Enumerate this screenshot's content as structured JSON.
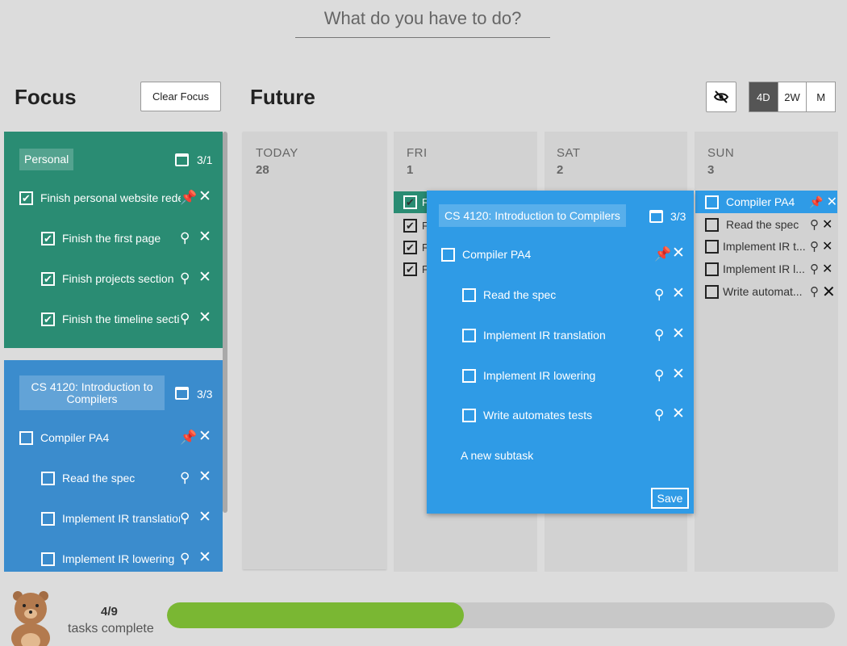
{
  "search": {
    "placeholder": "What do you have to do?"
  },
  "focus": {
    "title": "Focus",
    "clear_label": "Clear Focus",
    "groups": [
      {
        "tag": "Personal",
        "count": "3/1",
        "color": "#2a8c73",
        "task": {
          "label": "Finish personal website redesign",
          "checked": true
        },
        "subtasks": [
          {
            "label": "Finish the first page",
            "checked": true
          },
          {
            "label": "Finish projects section",
            "checked": true
          },
          {
            "label": "Finish the timeline section",
            "checked": true
          }
        ]
      },
      {
        "tag": "CS 4120: Introduction to Compilers",
        "count": "3/3",
        "color": "#3b8ccd",
        "task": {
          "label": "Compiler PA4",
          "checked": false
        },
        "subtasks": [
          {
            "label": "Read the spec",
            "checked": false
          },
          {
            "label": "Implement IR translation",
            "checked": false
          },
          {
            "label": "Implement IR lowering",
            "checked": false
          }
        ]
      }
    ]
  },
  "future": {
    "title": "Future",
    "views": [
      "4D",
      "2W",
      "M"
    ],
    "active_view": "4D",
    "days": [
      {
        "name": "TODAY",
        "num": "28"
      },
      {
        "name": "FRI",
        "num": "1"
      },
      {
        "name": "SAT",
        "num": "2"
      },
      {
        "name": "SUN",
        "num": "3"
      }
    ],
    "fri_items": [
      "Fi",
      "F",
      "F",
      "F"
    ],
    "sun_items": [
      {
        "label": "Compiler PA4",
        "highlight": true
      },
      {
        "label": "Read the spec"
      },
      {
        "label": "Implement IR t..."
      },
      {
        "label": "Implement IR l..."
      },
      {
        "label": "Write automat..."
      }
    ]
  },
  "popup": {
    "tag": "CS 4120: Introduction to Compilers",
    "count": "3/3",
    "task": "Compiler PA4",
    "subtasks": [
      "Read the spec",
      "Implement IR translation",
      "Implement IR lowering",
      "Write automates tests"
    ],
    "new_subtask": "A new subtask",
    "save_label": "Save"
  },
  "progress": {
    "count": "4/9",
    "label": "tasks complete",
    "fraction": 0.444
  },
  "colors": {
    "green": "#2a8c73",
    "blue": "#3b8ccd",
    "popup": "#2f9be6",
    "progress": "#7ab733"
  },
  "icons": [
    "pin-icon",
    "close-icon",
    "calendar-icon",
    "hide-icon",
    "bear-mascot"
  ]
}
